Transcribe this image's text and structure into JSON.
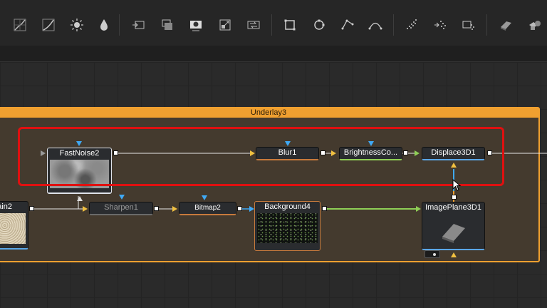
{
  "toolbar": {
    "icons": [
      "curves-icon",
      "gamma-icon",
      "brightness-icon",
      "color-drop-icon",
      "transform-icon",
      "merge-icon",
      "matte-icon",
      "resize-icon",
      "loop-icon",
      "rectangle-mask-icon",
      "ellipse-mask-icon",
      "polygon-mask-icon",
      "bspline-mask-icon",
      "particle-emitter-icon",
      "particle-render-icon",
      "particle-plane-icon",
      "shape3d-icon",
      "merge3d-icon"
    ]
  },
  "group": {
    "title": "Underlay3"
  },
  "nodes": {
    "fastnoise": "FastNoise2",
    "blur": "Blur1",
    "brightness": "BrightnessCo...",
    "displace": "Displace3D1",
    "plain": "ain2",
    "sharpen": "Sharpen1",
    "bitmap": "Bitmap2",
    "background": "Background4",
    "imageplane": "ImagePlane3D1"
  },
  "colors": {
    "accent_orange": "#f0a030",
    "highlight_red": "#e01010",
    "port_blue": "#3fa9f5",
    "port_yellow": "#f0c040",
    "wire_green": "#8fcf56"
  }
}
